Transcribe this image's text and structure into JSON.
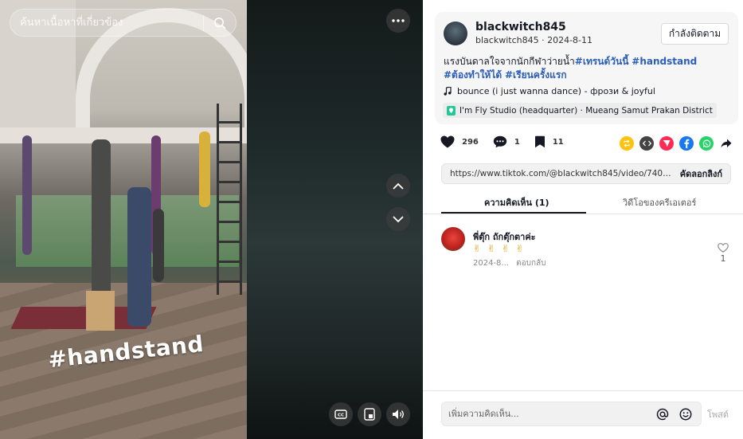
{
  "video": {
    "search_placeholder": "ค้นหาเนื้อหาที่เกี่ยวข้อง",
    "overlay_text": "#handstand"
  },
  "post": {
    "username": "blackwitch845",
    "handle": "blackwitch845",
    "date": "2024-8-11",
    "follow_label": "กำลังติดตาม",
    "caption_text": "แรงบันดาลใจจากนักกีฬาว่ายน้ำ",
    "caption_tags": [
      "#เทรนด์วันนี้",
      "#handstand",
      "#ต้องทำให้ได้",
      "#เรียนครั้งแรก"
    ],
    "music": "bounce (i just wanna dance) - фрози & joyful",
    "location": "I'm Fly Studio (headquarter) · Mueang Samut Prakan District"
  },
  "actions": {
    "likes": "296",
    "comments": "1",
    "saves": "11"
  },
  "share_colors": {
    "repost": "#fec30d",
    "embed": "#444444",
    "send": "#fe2c55",
    "facebook": "#1877f2",
    "whatsapp": "#25d366"
  },
  "link": {
    "url": "https://www.tiktok.com/@blackwitch845/video/74017...",
    "copy_label": "คัดลอกลิงก์"
  },
  "tabs": {
    "comments": "ความคิดเห็น (1)",
    "creator_videos": "วิดีโอของครีเอเตอร์"
  },
  "comment": {
    "name": "พี่ตุ๊ก ถักตุ๊กตาค่ะ",
    "text": "✌ ✌ ✌ ✌",
    "date": "2024-8...",
    "reply_label": "ตอบกลับ",
    "likes": "1"
  },
  "composer": {
    "placeholder": "เพิ่มความคิดเห็น...",
    "post_label": "โพสต์"
  }
}
